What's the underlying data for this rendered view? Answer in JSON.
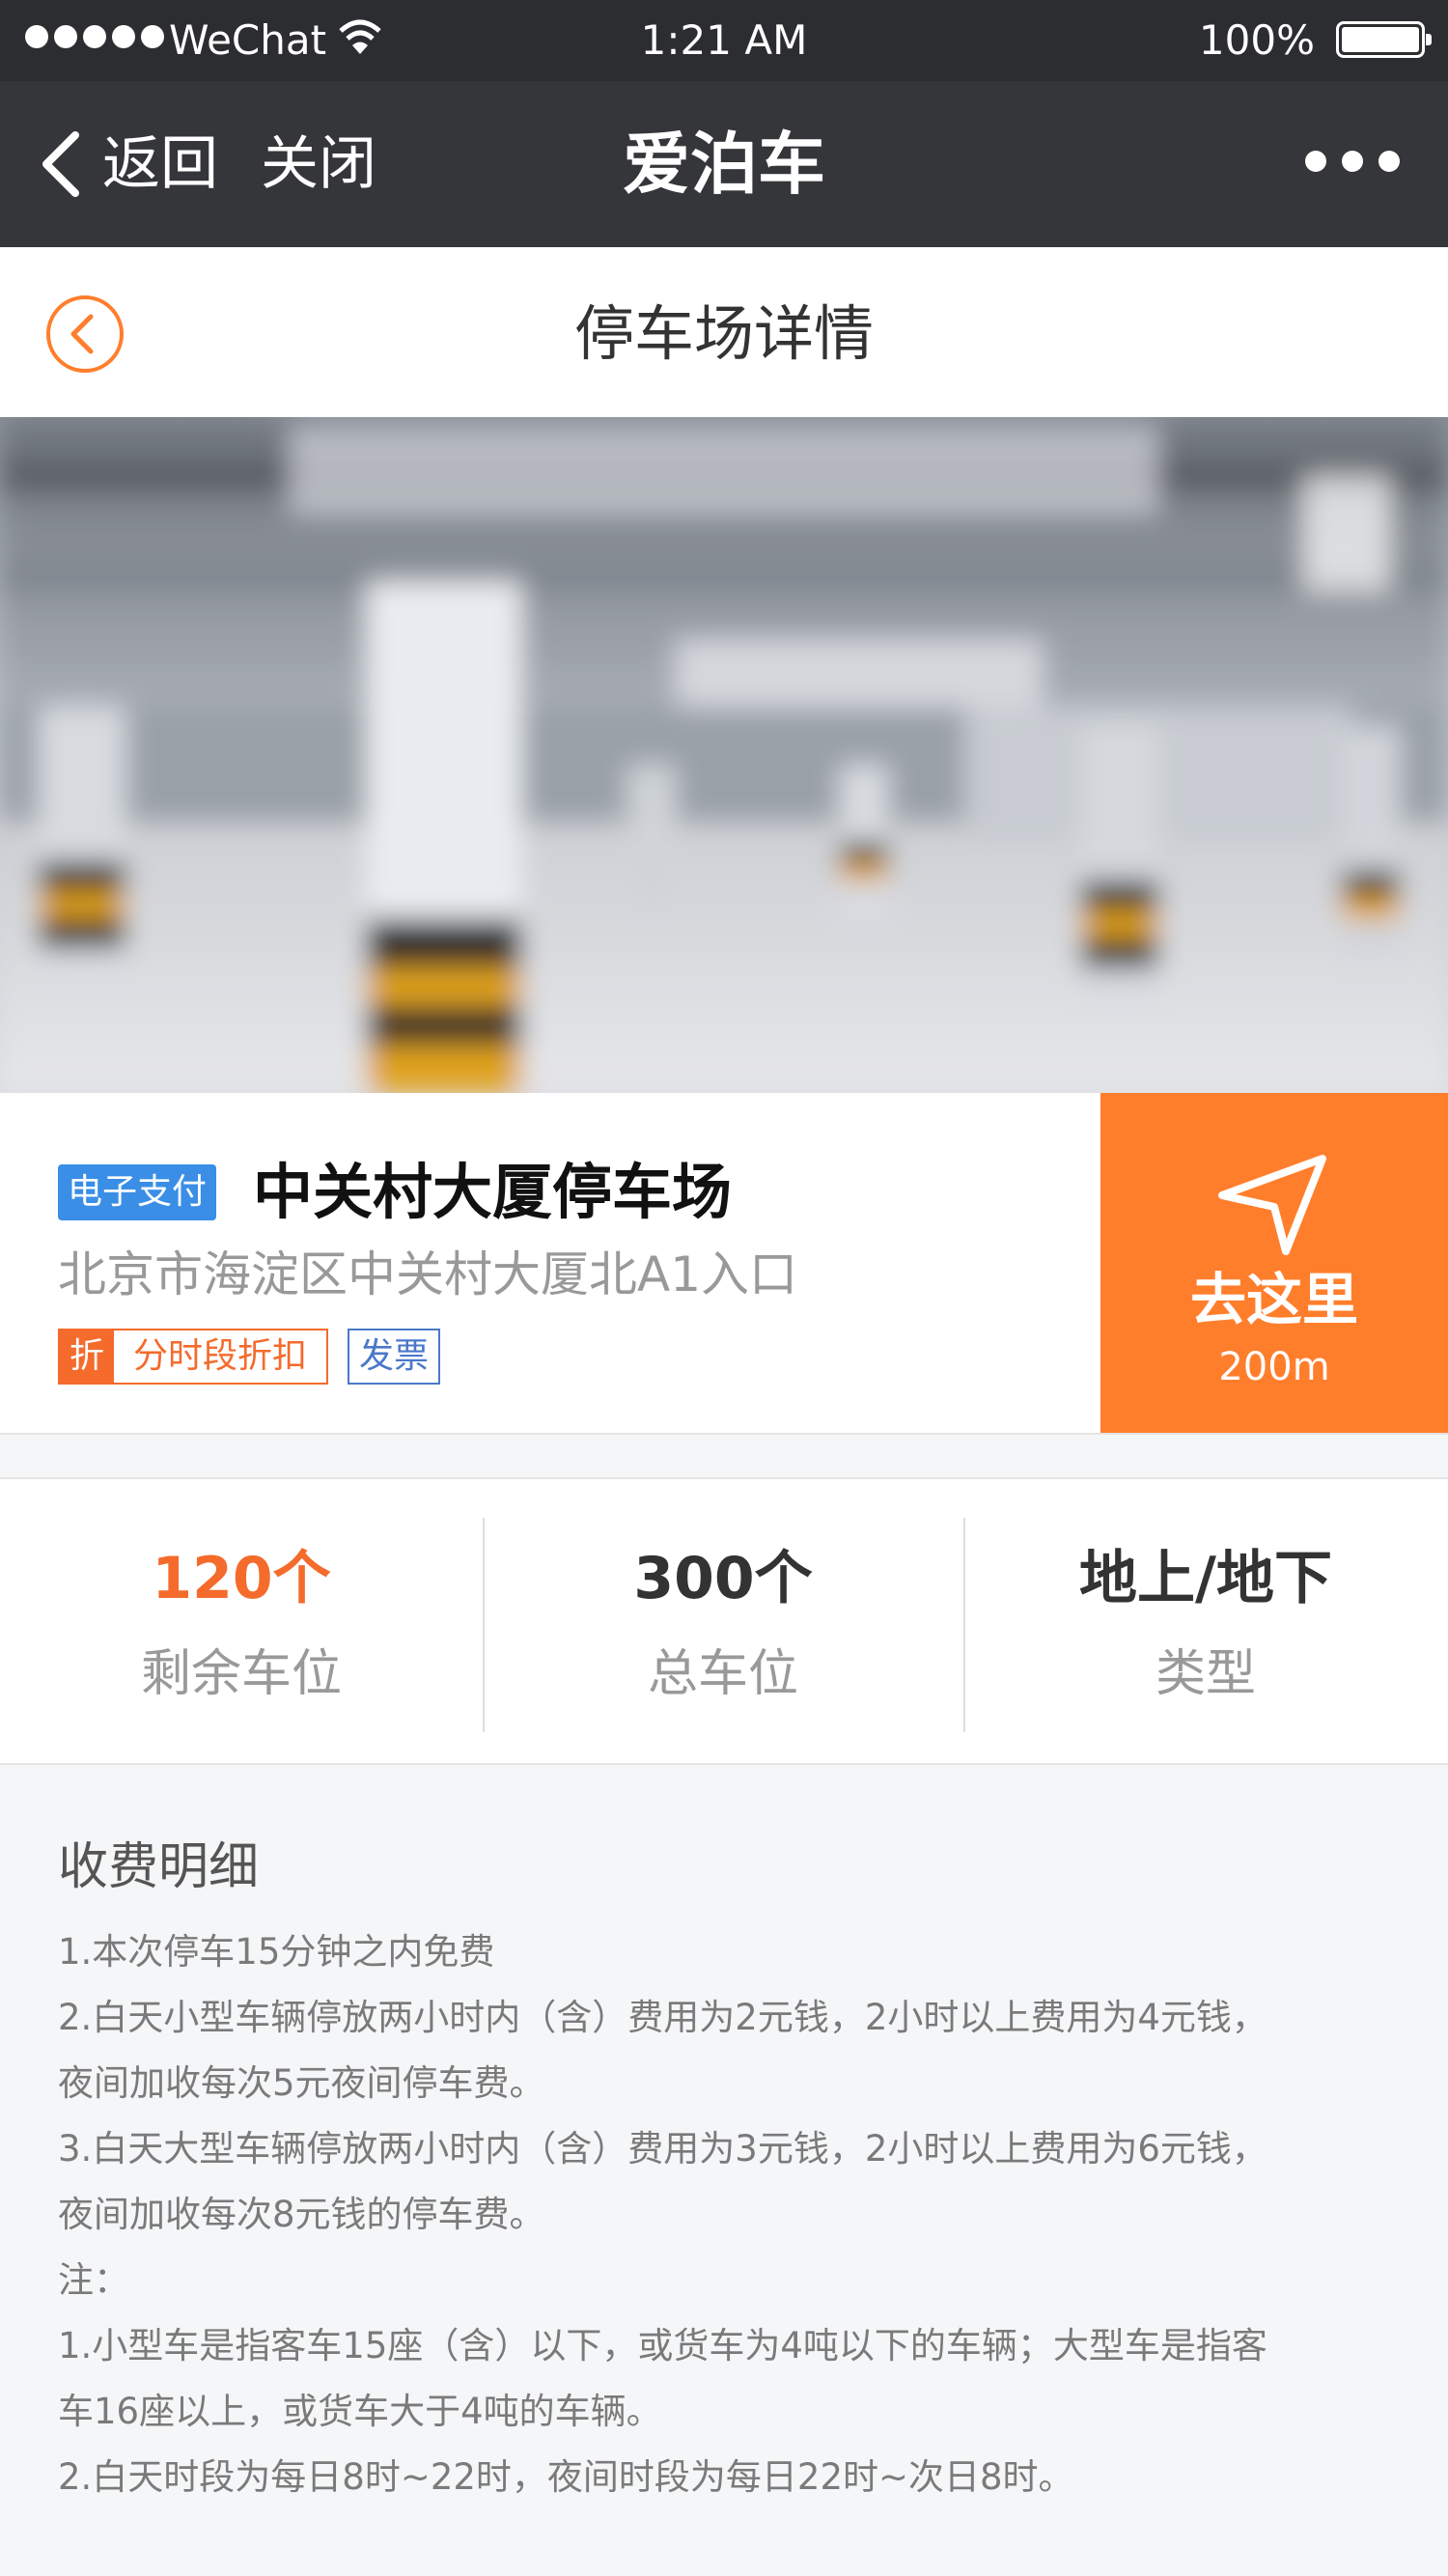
{
  "status_bar": {
    "carrier": "WeChat",
    "time": "1:21 AM",
    "battery": "100%"
  },
  "nav": {
    "back_label": "返回",
    "close_label": "关闭",
    "title": "爱泊车"
  },
  "page": {
    "title": "停车场详情"
  },
  "lot": {
    "pay_badge": "电子支付",
    "name": "中关村大厦停车场",
    "address": "北京市海淀区中关村大厦北A1入口",
    "discount_mark": "折",
    "discount_label": "分时段折扣",
    "invoice_label": "发票",
    "goto_label": "去这里",
    "distance": "200m"
  },
  "stats": [
    {
      "value": "120个",
      "label": "剩余车位"
    },
    {
      "value": "300个",
      "label": "总车位"
    },
    {
      "value": "地上/地下",
      "label": "类型"
    }
  ],
  "fees": {
    "title": "收费明细",
    "lines": [
      "1.本次停车15分钟之内免费",
      "2.白天小型车辆停放两小时内（含）费用为2元钱，2小时以上费用为4元钱，",
      "夜间加收每次5元夜间停车费。",
      "3.白天大型车辆停放两小时内（含）费用为3元钱，2小时以上费用为6元钱，",
      "夜间加收每次8元钱的停车费。",
      "注：",
      "1.小型车是指客车15座（含）以下，或货车为4吨以下的车辆；大型车是指客",
      "车16座以上，或货车大于4吨的车辆。",
      "2.白天时段为每日8时~22时，夜间时段为每日22时~次日8时。"
    ]
  },
  "colors": {
    "accent": "#ff7e2c",
    "pay_badge": "#3a8ee6",
    "invoice": "#4a78c9",
    "navbar": "#35363a"
  }
}
